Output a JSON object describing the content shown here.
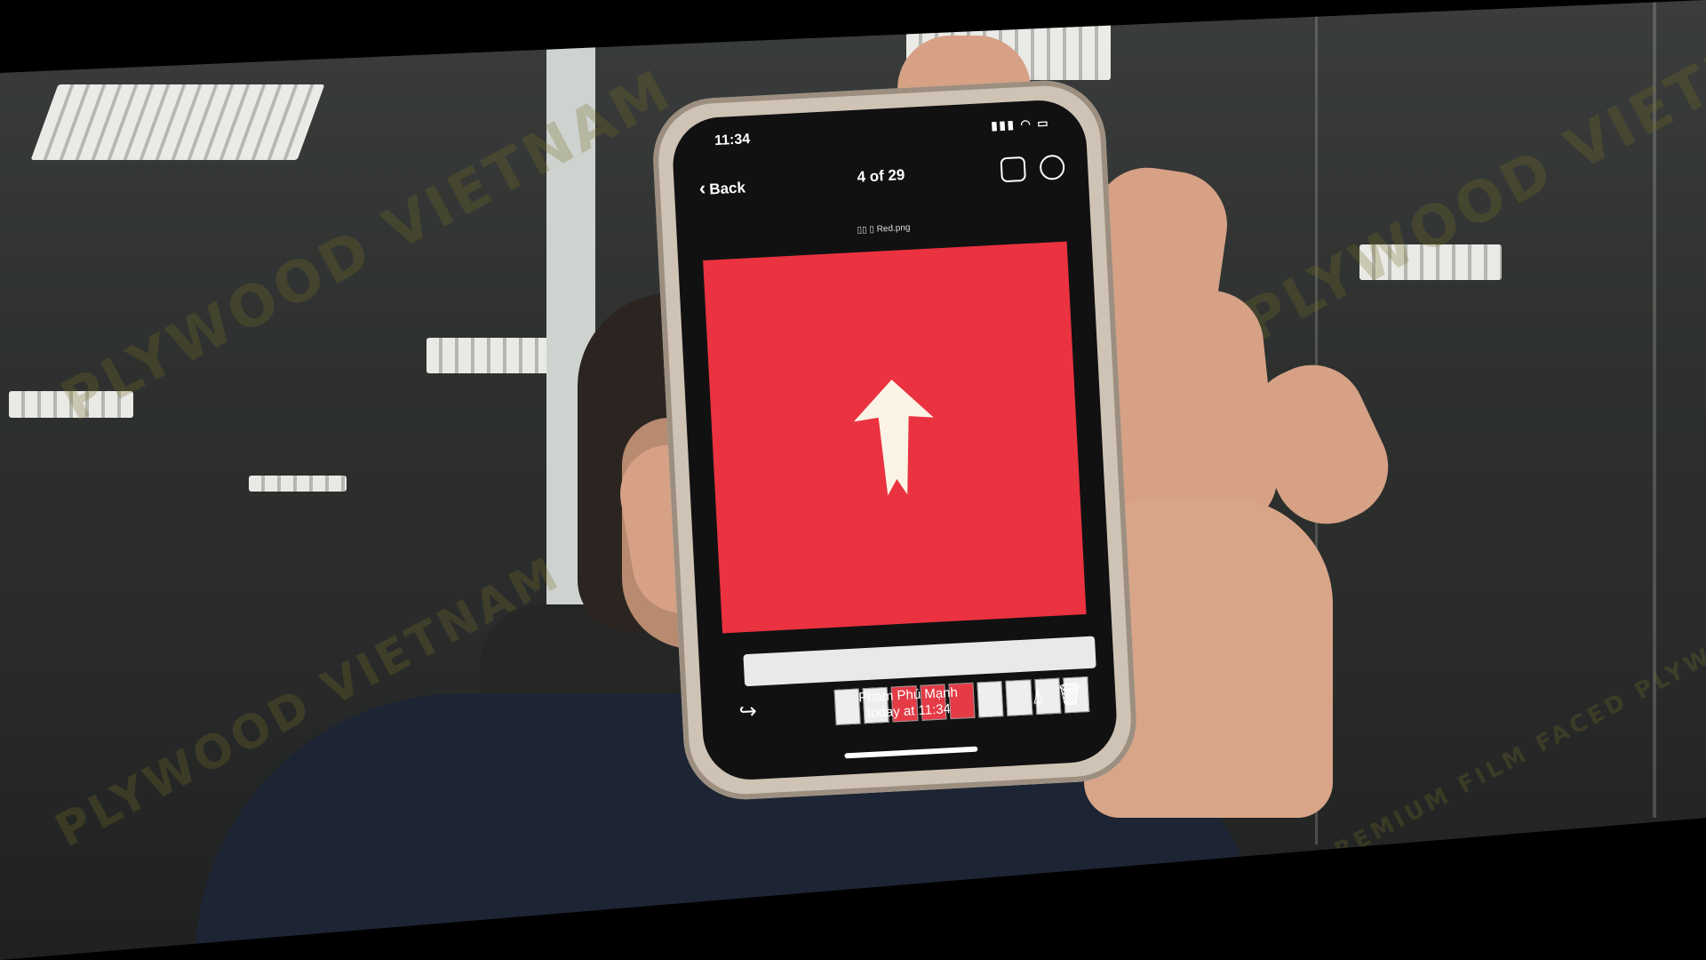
{
  "scene": {
    "watermark_text": "PLYWOOD VIETNAM",
    "watermark_sub": "PREMIUM FILM FACED PLYWOOD"
  },
  "phone": {
    "status": {
      "time": "11:34",
      "icons": "▮▮▮ ◠ ▭"
    },
    "nav": {
      "back_label": "Back",
      "counter": "4 of 29"
    },
    "image_filename": "▯▯ ▯ Red.png",
    "sender_name": "Phạm Phú Mạnh",
    "sender_time": "today at 11:34",
    "accent_red": "#ea3240"
  }
}
